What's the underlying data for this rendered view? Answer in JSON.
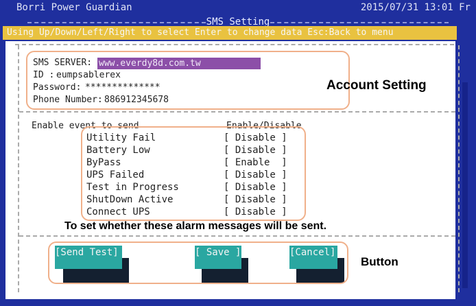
{
  "header": {
    "app_title": "Borri Power Guardian",
    "datetime": "2015/07/31 13:01 Fr",
    "screen_title": "SMS Setting"
  },
  "help_bar": "Using Up/Down/Left/Right to select Enter to change data  Esc:Back to menu",
  "account": {
    "server_label": "SMS SERVER:",
    "server_value": "www.everdy8d.com.tw",
    "id_label": "ID :",
    "id_value": "eumpsablerex",
    "password_label": "Password:",
    "password_value": "**************",
    "phone_label": "Phone Number:",
    "phone_value": "886912345678"
  },
  "events": {
    "header_left": "Enable event to send",
    "header_right": "Enable/Disable",
    "items": [
      {
        "name": "Utility Fail",
        "state": "[ Disable ]"
      },
      {
        "name": "Battery Low",
        "state": "[ Disable ]"
      },
      {
        "name": "ByPass",
        "state": "[ Enable  ]"
      },
      {
        "name": "UPS Failed",
        "state": "[ Disable ]"
      },
      {
        "name": "Test in Progress",
        "state": "[ Disable ]"
      },
      {
        "name": "ShutDown Active",
        "state": "[ Disable ]"
      },
      {
        "name": "Connect UPS",
        "state": "[ Disable ]"
      }
    ]
  },
  "buttons": {
    "send_test": "[Send Test]",
    "save": "[ Save ]",
    "cancel": "[Cancel]"
  },
  "annotations": {
    "account_setting": "Account Setting",
    "alarm_note": "To set whether these alarm messages will be sent.",
    "button": "Button"
  },
  "colors": {
    "terminal_bg": "#1f2f9e",
    "help_bar_bg": "#e9c240",
    "selection_bg": "#8c4fa8",
    "button_bg": "#2aa7a1",
    "annotation_border": "#f0b08a"
  }
}
